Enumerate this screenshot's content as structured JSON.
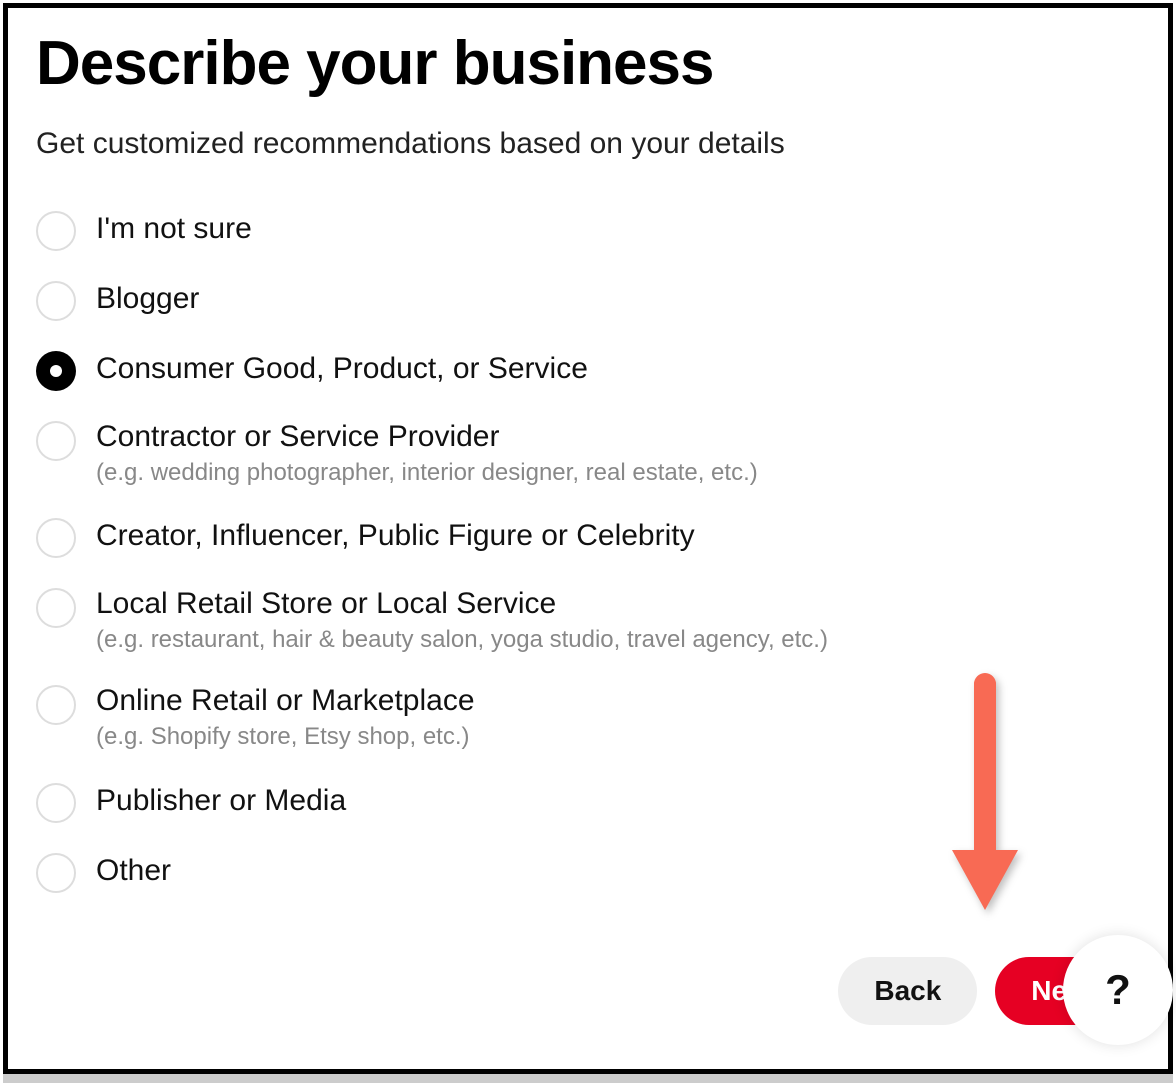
{
  "title": "Describe your business",
  "subtitle": "Get customized recommendations based on your details",
  "options": [
    {
      "label": "I'm not sure",
      "sub": "",
      "selected": false
    },
    {
      "label": "Blogger",
      "sub": "",
      "selected": false
    },
    {
      "label": "Consumer Good, Product, or Service",
      "sub": "",
      "selected": true
    },
    {
      "label": "Contractor or Service Provider",
      "sub": "(e.g. wedding photographer, interior designer, real estate, etc.)",
      "selected": false
    },
    {
      "label": "Creator, Influencer, Public Figure or Celebrity",
      "sub": "",
      "selected": false
    },
    {
      "label": "Local Retail Store or Local Service",
      "sub": "(e.g. restaurant, hair & beauty salon, yoga studio, travel agency, etc.)",
      "selected": false
    },
    {
      "label": "Online Retail or Marketplace",
      "sub": "(e.g. Shopify store, Etsy shop, etc.)",
      "selected": false
    },
    {
      "label": "Publisher or Media",
      "sub": "",
      "selected": false
    },
    {
      "label": "Other",
      "sub": "",
      "selected": false
    }
  ],
  "buttons": {
    "back": "Back",
    "next": "Next"
  },
  "help_label": "?",
  "colors": {
    "accent": "#e60023",
    "arrow": "#f86a54"
  }
}
